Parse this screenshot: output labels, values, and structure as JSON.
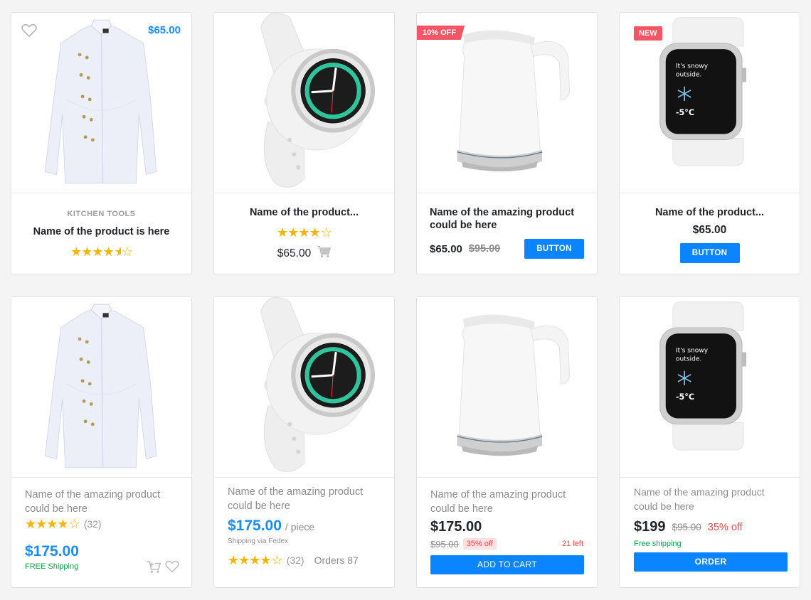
{
  "row1": {
    "card1": {
      "price": "$65.00",
      "category": "KITCHEN TOOLS",
      "title": "Name of the product is here"
    },
    "card2": {
      "title": "Name of the product...",
      "price": "$65.00"
    },
    "card3": {
      "badge": "10% OFF",
      "title": "Name of the amazing product could be here",
      "price": "$65.00",
      "old_price": "$95.00",
      "button": "BUTTON"
    },
    "card4": {
      "badge": "NEW",
      "title": "Name of the product...",
      "price": "$65.00",
      "button": "BUTTON"
    }
  },
  "row2": {
    "card1": {
      "title": "Name of the amazing product could be here",
      "rating_count": "(32)",
      "price": "$175.00",
      "shipping": "FREE Shipping"
    },
    "card2": {
      "title": "Name of the amazing product could be here",
      "price": "$175.00",
      "unit": "/ piece",
      "shipping": "Shipping via Fedex",
      "rating_count": "(32)",
      "orders": "Orders 87"
    },
    "card3": {
      "title": "Name of the amazing product could be here",
      "price": "$175.00",
      "old_price": "$95.00",
      "discount": "35% off",
      "stock": "21 left",
      "button": "ADD TO CART"
    },
    "card4": {
      "title": "Name of the amazing product could be here",
      "price": "$199",
      "old_price": "$95.00",
      "discount": "35% off",
      "shipping": "Free shipping",
      "button": "ORDER"
    }
  },
  "watch_screen": {
    "line1": "It's snowy",
    "line2": "outside.",
    "temp": "-5°C"
  },
  "ratings": {
    "row1_card1": 4.5,
    "row1_card2": 4.5,
    "row2_card1": 4.5,
    "row2_card2": 4.5
  },
  "colors": {
    "accent": "#0a84ff",
    "price_blue": "#1a8cff",
    "badge_red": "#f55564",
    "star": "#f7b500",
    "green": "#12a34b"
  }
}
